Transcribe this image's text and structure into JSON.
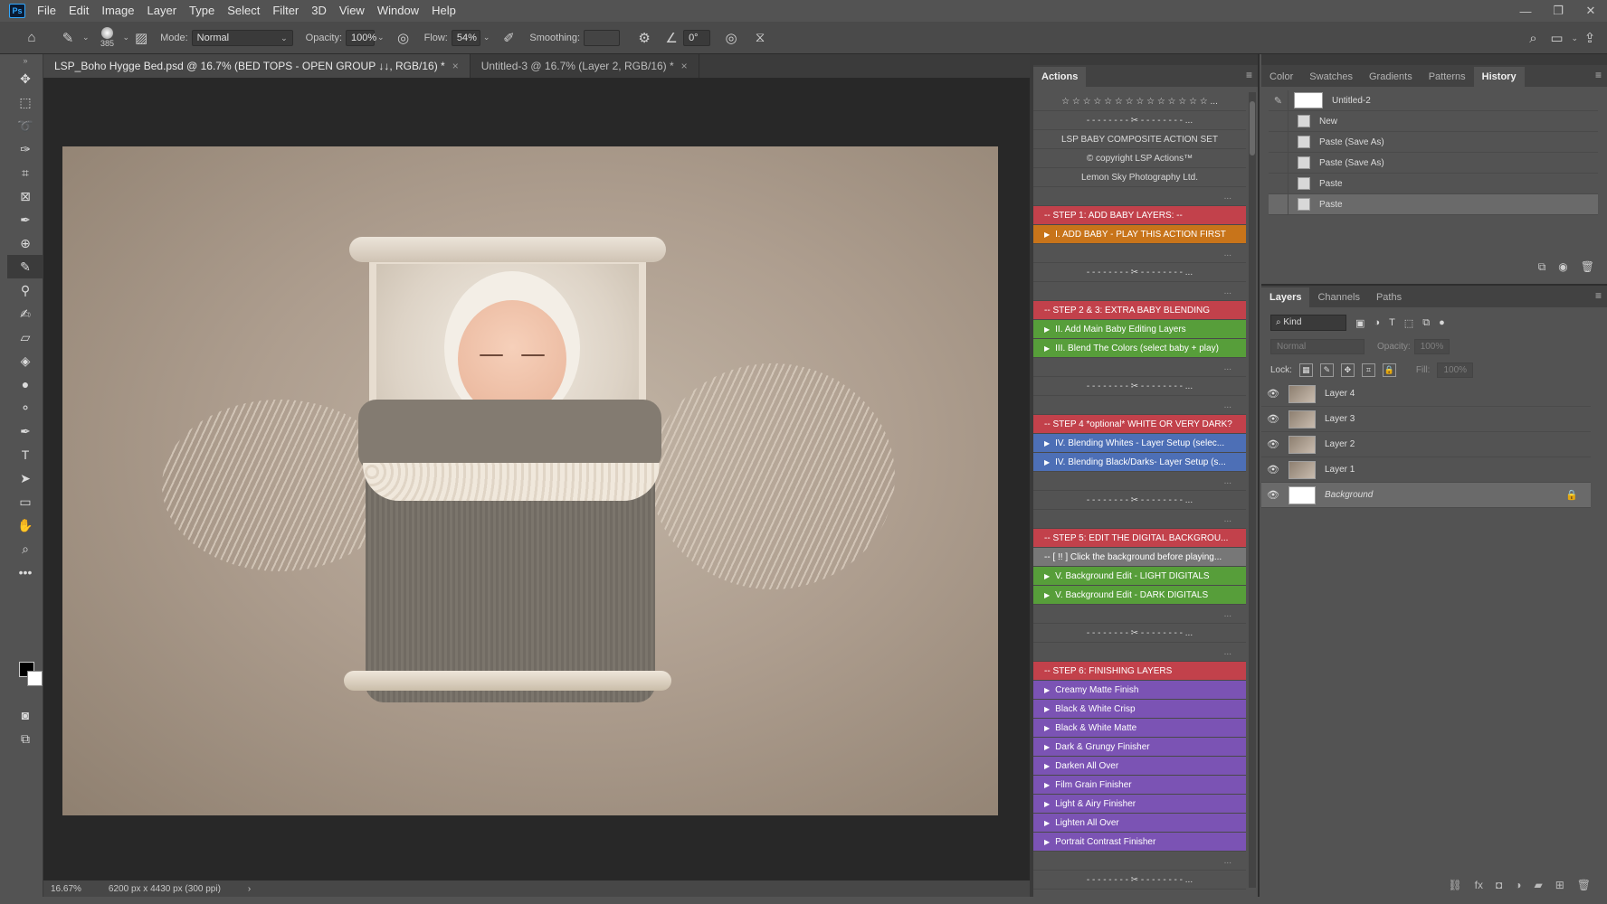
{
  "app": {
    "logo": "Ps"
  },
  "menu": [
    "File",
    "Edit",
    "Image",
    "Layer",
    "Type",
    "Select",
    "Filter",
    "3D",
    "View",
    "Window",
    "Help"
  ],
  "window_controls": [
    "minimize-icon",
    "restore-icon",
    "close-icon"
  ],
  "options_bar": {
    "brush_size": "385",
    "mode_label": "Mode:",
    "mode_value": "Normal",
    "opacity_label": "Opacity:",
    "opacity_value": "100%",
    "flow_label": "Flow:",
    "flow_value": "54%",
    "smoothing_label": "Smoothing:",
    "smoothing_value": "",
    "angle_value": "0°"
  },
  "doc_tabs": [
    {
      "title": "LSP_Boho Hygge Bed.psd @ 16.7% (BED TOPS - OPEN GROUP ↓↓, RGB/16) *",
      "close": "×"
    },
    {
      "title": "Untitled-3 @ 16.7% (Layer 2, RGB/16) *",
      "close": "×"
    }
  ],
  "status": {
    "zoom": "16.67%",
    "doc_size": "6200 px x 4430 px (300 ppi)",
    "arrow": "›"
  },
  "actions_panel": {
    "tabs": [
      "Actions"
    ],
    "rows": [
      {
        "text": "☆ ☆ ☆ ☆ ☆ ☆ ☆ ☆ ☆ ☆ ☆ ☆ ☆ ☆ ...",
        "style": "center",
        "tri": ""
      },
      {
        "text": "- - - - - - - - ✂ - - - - - - - - ...",
        "style": "center",
        "tri": ""
      },
      {
        "text": "LSP BABY COMPOSITE ACTION SET",
        "style": "center",
        "tri": ""
      },
      {
        "text": "© copyright LSP Actions™",
        "style": "center",
        "tri": ""
      },
      {
        "text": "Lemon Sky Photography Ltd.",
        "style": "center",
        "tri": ""
      },
      {
        "text": "...",
        "style": "dots",
        "tri": ""
      },
      {
        "text": "-- STEP 1: ADD BABY LAYERS: --",
        "style": "red",
        "tri": ""
      },
      {
        "text": "I. ADD BABY - PLAY THIS ACTION FIRST",
        "style": "orange",
        "tri": "▶"
      },
      {
        "text": "...",
        "style": "dots",
        "tri": ""
      },
      {
        "text": "- - - - - - - - ✂ - - - - - - - - ...",
        "style": "center",
        "tri": ""
      },
      {
        "text": "...",
        "style": "dots",
        "tri": ""
      },
      {
        "text": "-- STEP 2 & 3: EXTRA BABY BLENDING",
        "style": "red",
        "tri": ""
      },
      {
        "text": "II. Add Main Baby Editing Layers",
        "style": "green",
        "tri": "▶"
      },
      {
        "text": "III. Blend The Colors (select baby + play)",
        "style": "green",
        "tri": "▶"
      },
      {
        "text": "...",
        "style": "dots",
        "tri": ""
      },
      {
        "text": "- - - - - - - - ✂ - - - - - - - - ...",
        "style": "center",
        "tri": ""
      },
      {
        "text": "...",
        "style": "dots",
        "tri": ""
      },
      {
        "text": "-- STEP 4 *optional* WHITE OR VERY DARK?",
        "style": "red",
        "tri": ""
      },
      {
        "text": "IV. Blending Whites - Layer Setup (selec...",
        "style": "blue",
        "tri": "▶"
      },
      {
        "text": "IV. Blending Black/Darks- Layer Setup (s...",
        "style": "blue",
        "tri": "▶"
      },
      {
        "text": "...",
        "style": "dots",
        "tri": ""
      },
      {
        "text": "- - - - - - - - ✂ - - - - - - - - ...",
        "style": "center",
        "tri": ""
      },
      {
        "text": "...",
        "style": "dots",
        "tri": ""
      },
      {
        "text": "-- STEP 5: EDIT THE DIGITAL BACKGROU...",
        "style": "red",
        "tri": ""
      },
      {
        "text": "-- [ !! ] Click the background before playing...",
        "style": "gray",
        "tri": ""
      },
      {
        "text": "V. Background Edit - LIGHT DIGITALS",
        "style": "green",
        "tri": "▶"
      },
      {
        "text": "V. Background Edit - DARK DIGITALS",
        "style": "green",
        "tri": "▶"
      },
      {
        "text": "...",
        "style": "dots",
        "tri": ""
      },
      {
        "text": "- - - - - - - - ✂ - - - - - - - - ...",
        "style": "center",
        "tri": ""
      },
      {
        "text": "...",
        "style": "dots",
        "tri": ""
      },
      {
        "text": "-- STEP 6: FINISHING LAYERS",
        "style": "red",
        "tri": ""
      },
      {
        "text": "Creamy Matte Finish",
        "style": "violet",
        "tri": "▶"
      },
      {
        "text": "Black & White Crisp",
        "style": "violet",
        "tri": "▶"
      },
      {
        "text": "Black & White Matte",
        "style": "violet",
        "tri": "▶"
      },
      {
        "text": "Dark & Grungy Finisher",
        "style": "violet",
        "tri": "▶"
      },
      {
        "text": "Darken All Over",
        "style": "violet",
        "tri": "▶"
      },
      {
        "text": "Film Grain Finisher",
        "style": "violet",
        "tri": "▶"
      },
      {
        "text": "Light & Airy Finisher",
        "style": "violet",
        "tri": "▶"
      },
      {
        "text": "Lighten All Over",
        "style": "violet",
        "tri": "▶"
      },
      {
        "text": "Portrait Contrast Finisher",
        "style": "violet",
        "tri": "▶"
      },
      {
        "text": "...",
        "style": "dots",
        "tri": ""
      },
      {
        "text": "- - - - - - - - ✂ - - - - - - - - ...",
        "style": "center",
        "tri": ""
      }
    ]
  },
  "history_panel": {
    "tabs": [
      "Color",
      "Swatches",
      "Gradients",
      "Patterns",
      "History"
    ],
    "snapshot": "Untitled-2",
    "items": [
      {
        "label": "New",
        "selected": false
      },
      {
        "label": "Paste (Save As)",
        "selected": false
      },
      {
        "label": "Paste (Save As)",
        "selected": false
      },
      {
        "label": "Paste",
        "selected": false
      },
      {
        "label": "Paste",
        "selected": true
      }
    ]
  },
  "layers_panel": {
    "tabs": [
      "Layers",
      "Channels",
      "Paths"
    ],
    "filter_kind": "Kind",
    "blend_mode": "Normal",
    "opacity_label": "Opacity:",
    "opacity_value": "100%",
    "lock_label": "Lock:",
    "fill_label": "Fill:",
    "fill_value": "100%",
    "layers": [
      {
        "name": "Layer 4",
        "selected": false,
        "locked": false,
        "white": false
      },
      {
        "name": "Layer 3",
        "selected": false,
        "locked": false,
        "white": false
      },
      {
        "name": "Layer 2",
        "selected": false,
        "locked": false,
        "white": false
      },
      {
        "name": "Layer 1",
        "selected": false,
        "locked": false,
        "white": false
      },
      {
        "name": "Background",
        "selected": true,
        "locked": true,
        "white": true
      }
    ]
  },
  "colors": {
    "ps_blue": "#31a8ff",
    "step_red": "#c2414b",
    "action_orange": "#c8741a",
    "action_green": "#579e3a",
    "action_blue": "#4d6fb6",
    "action_violet": "#7b53b4"
  }
}
